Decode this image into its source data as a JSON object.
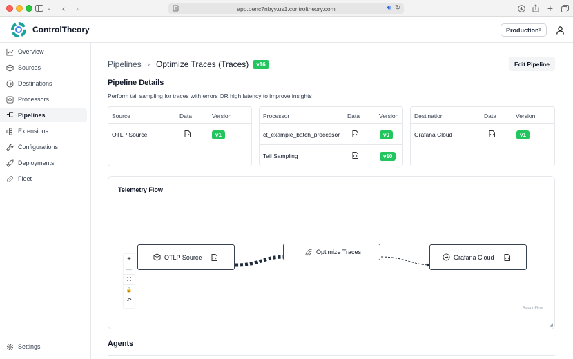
{
  "browser": {
    "url": "app.oenc7nbyy.us1.controltheory.com"
  },
  "header": {
    "brand": "ControlTheory",
    "environment": "Production",
    "colors": {
      "logo_primary": "#1aa39b",
      "logo_secondary": "#3b82f6"
    }
  },
  "sidebar": {
    "items": [
      {
        "label": "Overview",
        "icon": "chart-line-icon"
      },
      {
        "label": "Sources",
        "icon": "cube-icon"
      },
      {
        "label": "Destinations",
        "icon": "arrow-circle-icon"
      },
      {
        "label": "Processors",
        "icon": "cog-box-icon"
      },
      {
        "label": "Pipelines",
        "icon": "pipeline-icon",
        "active": true
      },
      {
        "label": "Extensions",
        "icon": "puzzle-icon"
      },
      {
        "label": "Configurations",
        "icon": "wrench-icon"
      },
      {
        "label": "Deployments",
        "icon": "rocket-icon"
      },
      {
        "label": "Fleet",
        "icon": "link-icon"
      }
    ],
    "settings": "Settings"
  },
  "breadcrumb": {
    "root": "Pipelines",
    "current": "Optimize Traces (Traces)",
    "version": "v16"
  },
  "actions": {
    "edit": "Edit Pipeline"
  },
  "details": {
    "title": "Pipeline Details",
    "description": "Perform tail sampling for traces with errors OR high latency to improve insights",
    "source": {
      "headers": {
        "name": "Source",
        "data": "Data",
        "version": "Version"
      },
      "rows": [
        {
          "name": "OTLP Source",
          "version": "v1"
        }
      ]
    },
    "processor": {
      "headers": {
        "name": "Processor",
        "data": "Data",
        "version": "Version"
      },
      "rows": [
        {
          "name": "ct_example_batch_processor",
          "version": "v0"
        },
        {
          "name": "Tail Sampling",
          "version": "v10"
        }
      ]
    },
    "destination": {
      "headers": {
        "name": "Destination",
        "data": "Data",
        "version": "Version"
      },
      "rows": [
        {
          "name": "Grafana Cloud",
          "version": "v1"
        }
      ]
    },
    "colors": {
      "version_badge": "#22c55e"
    }
  },
  "flow": {
    "title": "Telemetry Flow",
    "nodes": {
      "source": "OTLP Source",
      "processor": "Optimize Traces",
      "destination": "Grafana Cloud"
    },
    "controls": [
      "+",
      "—",
      "⛶",
      "🔒",
      "↶"
    ],
    "attribution": "React Flow"
  },
  "agents": {
    "title": "Agents"
  }
}
